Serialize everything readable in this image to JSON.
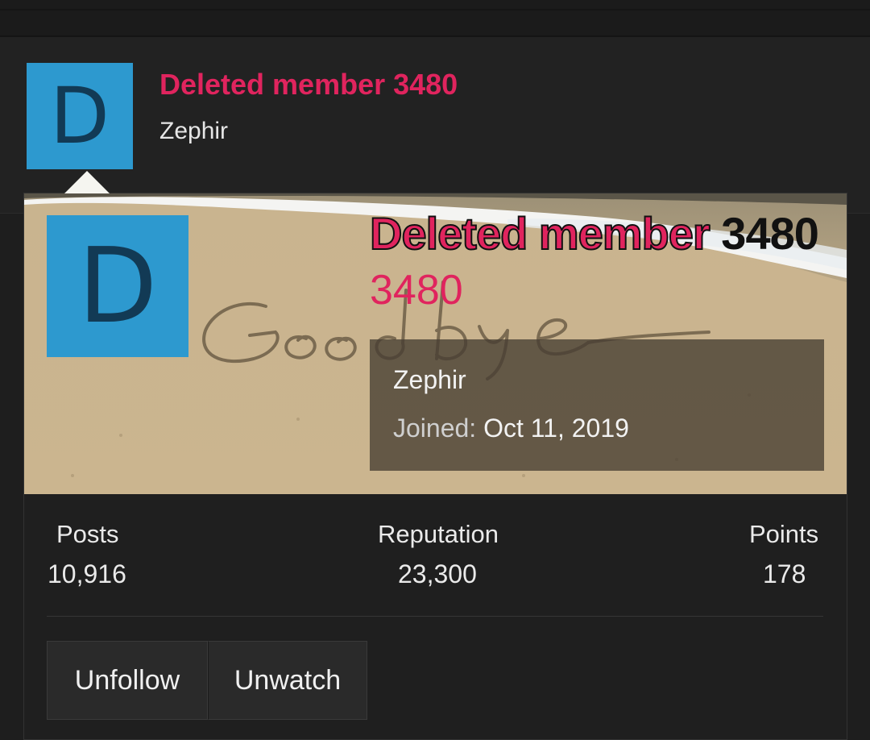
{
  "post_header": {
    "avatar_letter": "D",
    "username": "Deleted member 3480",
    "user_title": "Zephir"
  },
  "member_card": {
    "avatar_letter": "D",
    "username_part1": "Deleted member",
    "username_part2": "3480",
    "username_wrapped": "3480",
    "banner_image_text": "Goodbye",
    "user_title": "Zephir",
    "joined_label": "Joined:",
    "joined_date": "Oct 11, 2019"
  },
  "stats": [
    {
      "label": "Posts",
      "value": "10,916"
    },
    {
      "label": "Reputation",
      "value": "23,300"
    },
    {
      "label": "Points",
      "value": "178"
    }
  ],
  "buttons": {
    "unfollow": "Unfollow",
    "unwatch": "Unwatch"
  },
  "colors": {
    "accent_pink": "#e0245e",
    "avatar_blue": "#2d99cf",
    "avatar_letter": "#123a55"
  }
}
